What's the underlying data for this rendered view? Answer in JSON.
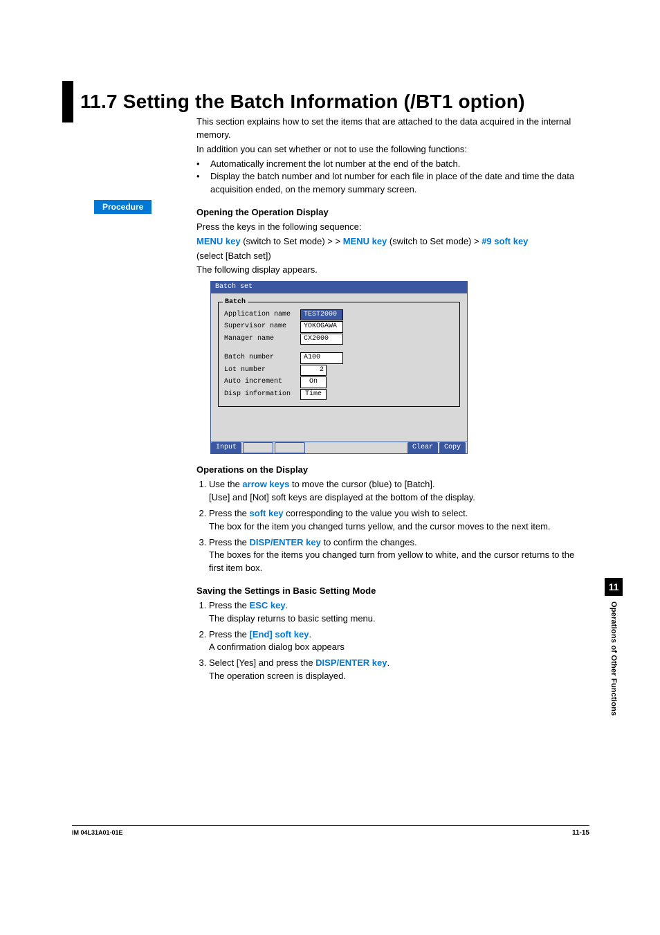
{
  "heading": "11.7  Setting the Batch Information  (/BT1 option)",
  "intro": {
    "p1": "This section explains how to set the items that are attached to the data acquired in the internal memory.",
    "p2": "In addition you can set whether or not to use the following functions:",
    "b1": "Automatically increment the lot number at the end of the batch.",
    "b2": "Display the batch number and lot number for each file in place of the date and time the data acquisition ended, on the memory summary screen."
  },
  "procedure_label": "Procedure",
  "opening": {
    "h": "Opening the Operation Display",
    "p1": "Press the keys in the following sequence:",
    "k1": "MENU key",
    "t1": " (switch to Set mode) > > ",
    "k2": "MENU key",
    "t2": " (switch to Set mode) > ",
    "k3": "#9 soft key",
    "t3": "(select [Batch set])",
    "p3": "The following display appears."
  },
  "screenshot": {
    "title": "Batch set",
    "legend": "Batch",
    "rows": {
      "r1l": "Application name",
      "r1v": "TEST2000",
      "r2l": "Supervisor name",
      "r2v": "YOKOGAWA",
      "r3l": "Manager name",
      "r3v": "CX2000",
      "r4l": "Batch number",
      "r4v": "A100",
      "r5l": "Lot number",
      "r5v": "2",
      "r6l": "Auto increment",
      "r6v": "On",
      "r7l": "Disp information",
      "r7v": "Time"
    },
    "softkeys": {
      "input": "Input",
      "clear": "Clear",
      "copy": "Copy"
    }
  },
  "ops": {
    "h": "Operations on the Display",
    "s1a": "Use the ",
    "s1k": "arrow keys",
    "s1b": " to move the cursor (blue) to [Batch].",
    "s1c": "[Use] and [Not] soft keys are displayed at the bottom of the display.",
    "s2a": "Press the ",
    "s2k": "soft key",
    "s2b": " corresponding to the value you wish to select.",
    "s2c": "The box for the item you changed turns yellow, and the cursor moves to the next item.",
    "s3a": "Press the ",
    "s3k": "DISP/ENTER key",
    "s3b": " to confirm the changes.",
    "s3c": "The boxes for the items you changed turn from yellow to white, and the cursor returns to the first item box."
  },
  "saving": {
    "h": "Saving the Settings in Basic Setting Mode",
    "s1a": "Press the ",
    "s1k": "ESC key",
    "s1b": ".",
    "s1c": "The display returns to basic setting menu.",
    "s2a": "Press the ",
    "s2k": "[End] soft key",
    "s2b": ".",
    "s2c": "A confirmation dialog box appears",
    "s3a": "Select [Yes] and press the ",
    "s3k": "DISP/ENTER key",
    "s3b": ".",
    "s3c": "The operation screen is displayed."
  },
  "side": {
    "num": "11",
    "label": "Operations of Other Functions"
  },
  "footer": {
    "left": "IM 04L31A01-01E",
    "right": "11-15"
  }
}
